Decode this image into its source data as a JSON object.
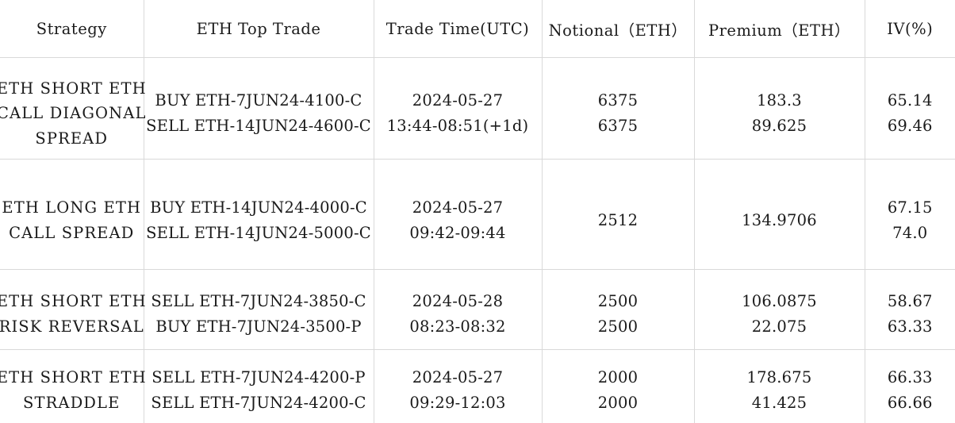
{
  "table": {
    "columns": [
      {
        "key": "strategy",
        "label": "Strategy"
      },
      {
        "key": "top_trade",
        "label": "ETH Top Trade"
      },
      {
        "key": "trade_time",
        "label": "Trade Time(UTC)"
      },
      {
        "key": "notional",
        "label": "Notional（ETH）"
      },
      {
        "key": "premium",
        "label": "Premium（ETH）"
      },
      {
        "key": "iv",
        "label": "IV(%)"
      }
    ],
    "rows": [
      {
        "strategy": [
          "ETH SHORT ETH",
          "CALL DIAGONAL",
          "SPREAD"
        ],
        "top_trade": [
          "BUY ETH-7JUN24-4100-C",
          "SELL ETH-14JUN24-4600-C"
        ],
        "trade_time": [
          "2024-05-27",
          "13:44-08:51(+1d)"
        ],
        "notional": [
          "6375",
          "6375"
        ],
        "premium": [
          "183.3",
          "89.625"
        ],
        "iv": [
          "65.14",
          "69.46"
        ]
      },
      {
        "strategy": [
          "ETH LONG ETH",
          "CALL SPREAD"
        ],
        "top_trade": [
          "BUY ETH-14JUN24-4000-C",
          "SELL ETH-14JUN24-5000-C"
        ],
        "trade_time": [
          "2024-05-27",
          "09:42-09:44"
        ],
        "notional": [
          "2512"
        ],
        "premium": [
          "134.9706"
        ],
        "iv": [
          "67.15",
          "74.0"
        ]
      },
      {
        "strategy": [
          "ETH SHORT ETH",
          "RISK REVERSAL"
        ],
        "top_trade": [
          "SELL ETH-7JUN24-3850-C",
          "BUY ETH-7JUN24-3500-P"
        ],
        "trade_time": [
          "2024-05-28",
          "08:23-08:32"
        ],
        "notional": [
          "2500",
          "2500"
        ],
        "premium": [
          "106.0875",
          "22.075"
        ],
        "iv": [
          "58.67",
          "63.33"
        ]
      },
      {
        "strategy": [
          "ETH SHORT ETH",
          "STRADDLE"
        ],
        "top_trade": [
          "SELL ETH-7JUN24-4200-P",
          "SELL ETH-7JUN24-4200-C"
        ],
        "trade_time": [
          "2024-05-27",
          "09:29-12:03"
        ],
        "notional": [
          "2000",
          "2000"
        ],
        "premium": [
          "178.675",
          "41.425"
        ],
        "iv": [
          "66.33",
          "66.66"
        ]
      }
    ],
    "colors": {
      "text": "#1a1a1a",
      "border": "#d9d9d9",
      "background": "#ffffff"
    }
  }
}
